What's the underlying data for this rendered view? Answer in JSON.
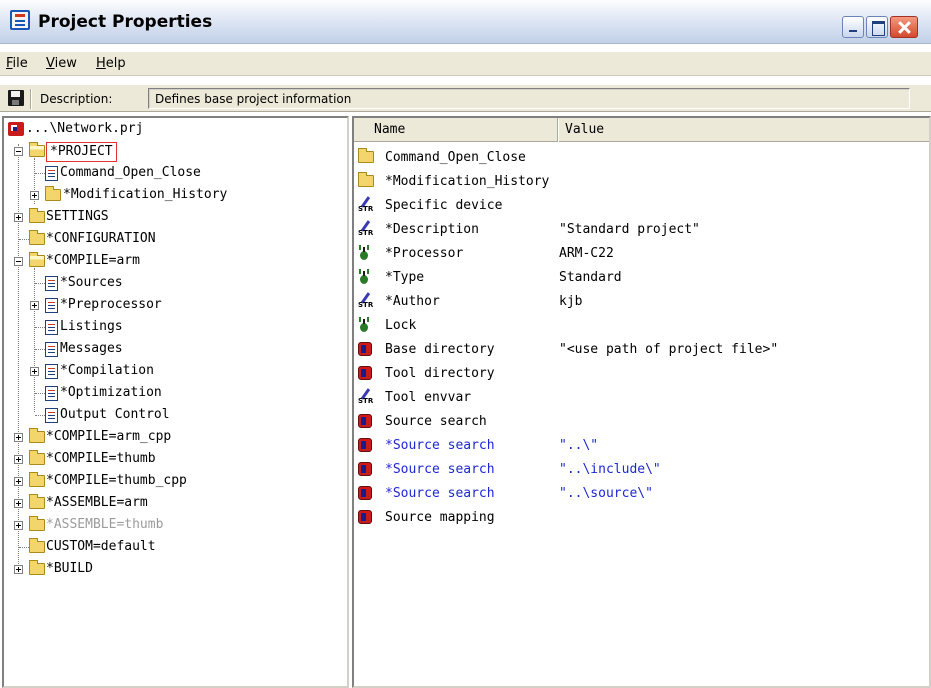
{
  "window": {
    "title": "Project Properties",
    "controls": {
      "minimize": "minimize",
      "maximize": "maximize",
      "close": "close"
    }
  },
  "menu": {
    "items": [
      {
        "key": "F",
        "rest": "ile"
      },
      {
        "key": "V",
        "rest": "iew"
      },
      {
        "key": "H",
        "rest": "elp"
      }
    ]
  },
  "toolbar": {
    "description_label": "Description:",
    "description_value": "Defines base project information"
  },
  "tree": {
    "root": "...\\Network.prj",
    "items": [
      {
        "label": "*PROJECT",
        "icon": "folder-open-icon",
        "selected": true
      },
      {
        "label": "Command_Open_Close",
        "icon": "document-icon"
      },
      {
        "label": "*Modification_History",
        "icon": "folder-icon"
      },
      {
        "label": "SETTINGS",
        "icon": "folder-icon"
      },
      {
        "label": "*CONFIGURATION",
        "icon": "folder-icon"
      },
      {
        "label": "*COMPILE=arm",
        "icon": "folder-open-icon"
      },
      {
        "label": "*Sources",
        "icon": "document-icon"
      },
      {
        "label": "*Preprocessor",
        "icon": "document-icon"
      },
      {
        "label": "Listings",
        "icon": "document-icon"
      },
      {
        "label": "Messages",
        "icon": "document-icon"
      },
      {
        "label": "*Compilation",
        "icon": "document-icon"
      },
      {
        "label": "*Optimization",
        "icon": "document-icon"
      },
      {
        "label": "Output Control",
        "icon": "document-icon"
      },
      {
        "label": "*COMPILE=arm_cpp",
        "icon": "folder-icon"
      },
      {
        "label": "*COMPILE=thumb",
        "icon": "folder-icon"
      },
      {
        "label": "*COMPILE=thumb_cpp",
        "icon": "folder-icon"
      },
      {
        "label": "*ASSEMBLE=arm",
        "icon": "folder-icon"
      },
      {
        "label": "*ASSEMBLE=thumb",
        "icon": "folder-icon",
        "disabled": true
      },
      {
        "label": "CUSTOM=default",
        "icon": "folder-icon"
      },
      {
        "label": "*BUILD",
        "icon": "folder-icon"
      }
    ]
  },
  "list": {
    "columns": {
      "name": "Name",
      "value": "Value"
    },
    "rows": [
      {
        "name": "Command_Open_Close",
        "value": "",
        "icon": "folder-icon"
      },
      {
        "name": "*Modification_History",
        "value": "",
        "icon": "folder-icon"
      },
      {
        "name": "Specific device",
        "value": "",
        "icon": "string-icon"
      },
      {
        "name": "*Description",
        "value": "\"Standard project\"",
        "icon": "string-icon"
      },
      {
        "name": "*Processor",
        "value": "ARM-C22",
        "icon": "bug-icon"
      },
      {
        "name": "*Type",
        "value": "Standard",
        "icon": "bug-icon"
      },
      {
        "name": "*Author",
        "value": "kjb",
        "icon": "string-icon"
      },
      {
        "name": "Lock",
        "value": "",
        "icon": "bug-icon"
      },
      {
        "name": "Base directory",
        "value": "\"<use path of project file>\"",
        "icon": "database-icon"
      },
      {
        "name": "Tool directory",
        "value": "",
        "icon": "database-icon"
      },
      {
        "name": "Tool envvar",
        "value": "",
        "icon": "string-icon"
      },
      {
        "name": "Source search",
        "value": "",
        "icon": "database-icon"
      },
      {
        "name": "*Source search",
        "value": "\"..\\\"",
        "icon": "database-icon",
        "highlight": true
      },
      {
        "name": "*Source search",
        "value": "\"..\\include\\\"",
        "icon": "database-icon",
        "highlight": true
      },
      {
        "name": "*Source search",
        "value": "\"..\\source\\\"",
        "icon": "database-icon",
        "highlight": true
      },
      {
        "name": "Source mapping",
        "value": "",
        "icon": "database-icon"
      }
    ]
  },
  "colors": {
    "highlight_text": "#1d27d4",
    "selection_border": "#e0342e",
    "disabled_text": "#9c9c9c"
  }
}
